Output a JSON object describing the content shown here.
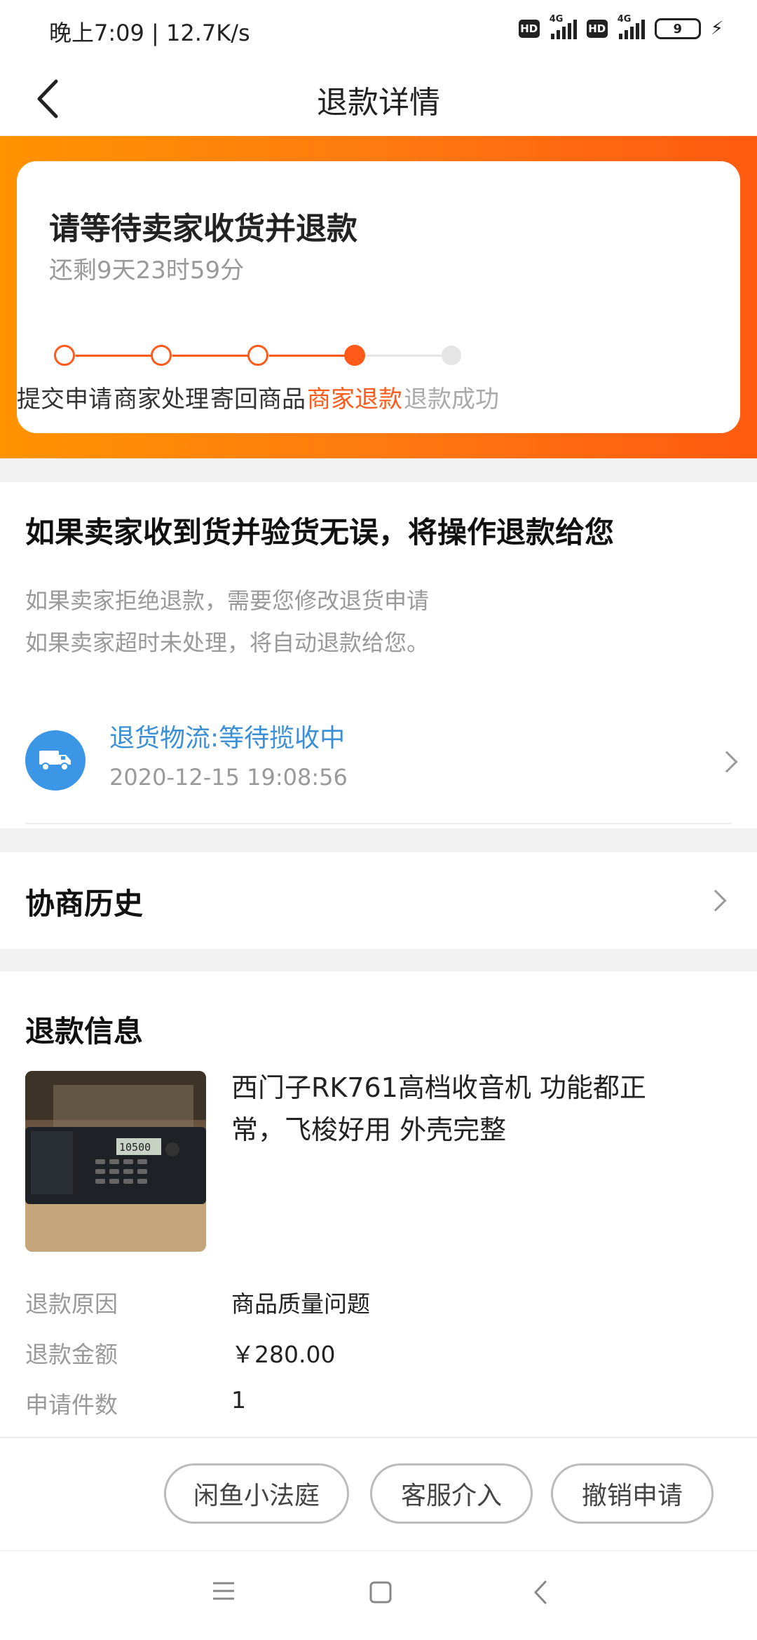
{
  "status_bar": {
    "time": "晚上7:09 | 12.7K/s",
    "hd1": "HD",
    "net1": "4G",
    "hd2": "HD",
    "net2": "4G",
    "battery": "9"
  },
  "header": {
    "title": "退款详情"
  },
  "status_card": {
    "title": "请等待卖家收货并退款",
    "countdown": "还剩9天23时59分",
    "accent_color": "#ff5a1a",
    "steps": [
      {
        "label": "提交申请",
        "state": "done"
      },
      {
        "label": "商家处理",
        "state": "done"
      },
      {
        "label": "寄回商品",
        "state": "done"
      },
      {
        "label": "商家退款",
        "state": "current"
      },
      {
        "label": "退款成功",
        "state": "pending"
      }
    ]
  },
  "notice": {
    "title": "如果卖家收到货并验货无误，将操作退款给您",
    "line1": "如果卖家拒绝退款，需要您修改退货申请",
    "line2": "如果卖家超时未处理，将自动退款给您。",
    "logistics_status": "退货物流:等待揽收中",
    "logistics_time": "2020-12-15 19:08:56",
    "logistics_icon": "truck-icon"
  },
  "history": {
    "title": "协商历史"
  },
  "refund": {
    "title": "退款信息",
    "product_name": "西门子RK761高档收音机 功能都正常，飞梭好用 外壳完整",
    "screen_text": "10500",
    "reason_label": "退款原因",
    "reason_value": "商品质量问题",
    "amount_label": "退款金额",
    "amount_value": "￥280.00",
    "count_label": "申请件数",
    "count_value": "1"
  },
  "actions": {
    "court": "闲鱼小法庭",
    "service": "客服介入",
    "cancel": "撤销申请"
  }
}
